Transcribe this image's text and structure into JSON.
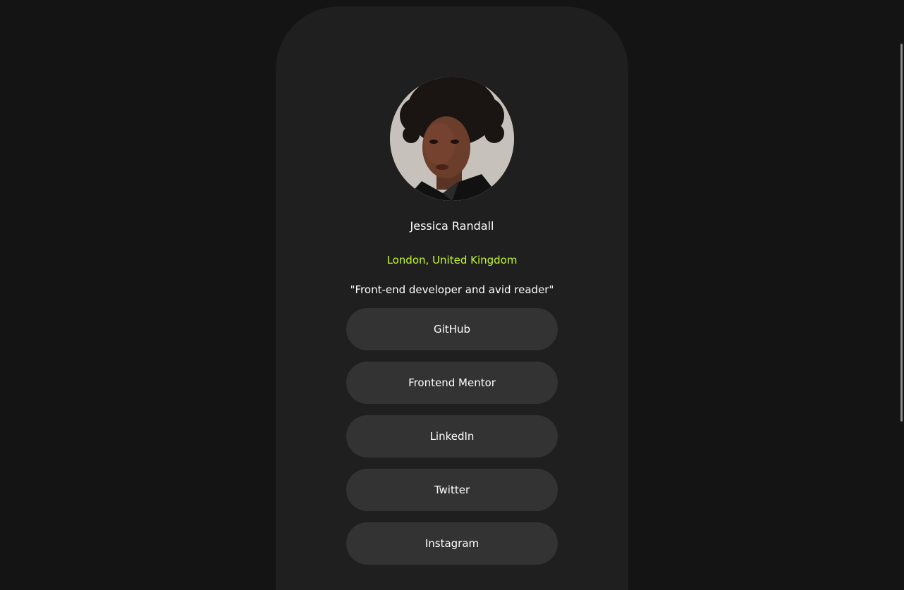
{
  "profile": {
    "avatar_alt": "Jessica Randall",
    "name": "Jessica Randall",
    "location": "London, United Kingdom",
    "bio": "\"Front-end developer and avid reader\""
  },
  "links": [
    {
      "label": "GitHub"
    },
    {
      "label": "Frontend Mentor"
    },
    {
      "label": "LinkedIn"
    },
    {
      "label": "Twitter"
    },
    {
      "label": "Instagram"
    }
  ],
  "colors": {
    "background": "#141414",
    "card": "#1f1f1f",
    "button": "#333333",
    "accent": "#c4f82a",
    "text": "#ffffff"
  }
}
